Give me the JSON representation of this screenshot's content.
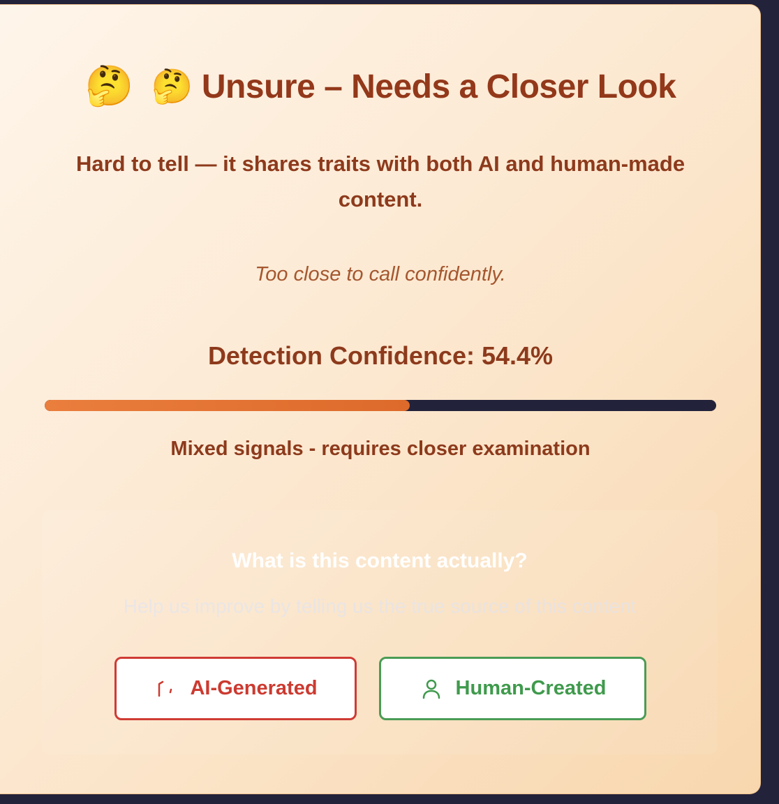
{
  "result": {
    "leading_emoji": "🤔",
    "title": "🤔 Unsure – Needs a Closer Look",
    "description": "Hard to tell — it shares traits with both AI and human-made content.",
    "note": "Too close to call confidently.",
    "confidence_text": "Detection Confidence: 54.4%",
    "confidence_value": 54.4,
    "confidence_explanation": "Mixed signals - requires closer examination"
  },
  "feedback": {
    "question": "What is this content actually?",
    "help_text": "Help us improve by telling us the true source of this content",
    "ai_button_label": "AI-Generated",
    "ai_button_icon": "ai-chip-icon",
    "human_button_label": "Human-Created",
    "human_button_icon": "user-icon"
  },
  "colors": {
    "title": "#93381a",
    "bar_fill": "#e2712f",
    "bar_track": "#23223b",
    "ai_accent": "#cf3b34",
    "human_accent": "#4a9c55"
  }
}
